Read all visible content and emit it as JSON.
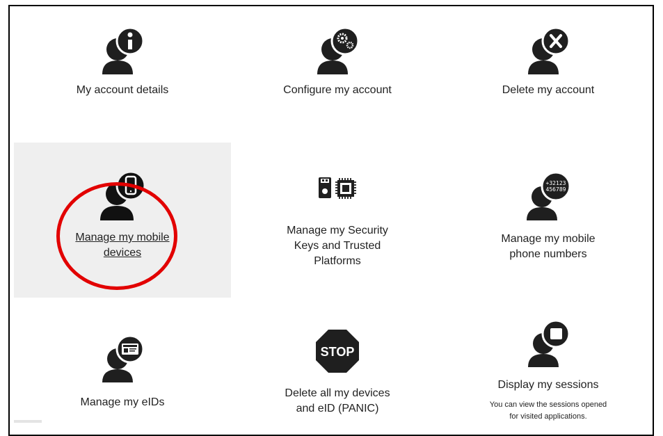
{
  "tiles": {
    "account_details": {
      "label": "My account details"
    },
    "configure_account": {
      "label": "Configure my account"
    },
    "delete_account": {
      "label": "Delete my account"
    },
    "mobile_devices": {
      "label_line1": "Manage my mobile",
      "label_line2": "devices"
    },
    "security_keys": {
      "label_line1": "Manage my Security",
      "label_line2": "Keys and Trusted",
      "label_line3": "Platforms"
    },
    "phone_numbers": {
      "label_line1": "Manage my mobile",
      "label_line2": "phone numbers",
      "icon_text_line1": "+32123",
      "icon_text_line2": "456789"
    },
    "eids": {
      "label": "Manage my eIDs"
    },
    "panic": {
      "label_line1": "Delete all my devices",
      "label_line2": "and eID (PANIC)",
      "icon_text": "STOP"
    },
    "sessions": {
      "label": "Display my sessions",
      "desc_line1": "You can view the sessions opened",
      "desc_line2": "for visited applications."
    }
  },
  "icons": {
    "account_details": "info-icon",
    "configure_account": "gears-icon",
    "delete_account": "x-icon",
    "mobile_devices": "phone-icon",
    "security_keys": "security-key-chip-icon",
    "phone_numbers": "number-icon",
    "eids": "id-card-icon",
    "panic": "stop-sign-icon",
    "sessions": "session-window-icon"
  },
  "colors": {
    "icon": "#1f1f1f",
    "highlight": "#e20000",
    "hover_bg": "#efefef"
  }
}
